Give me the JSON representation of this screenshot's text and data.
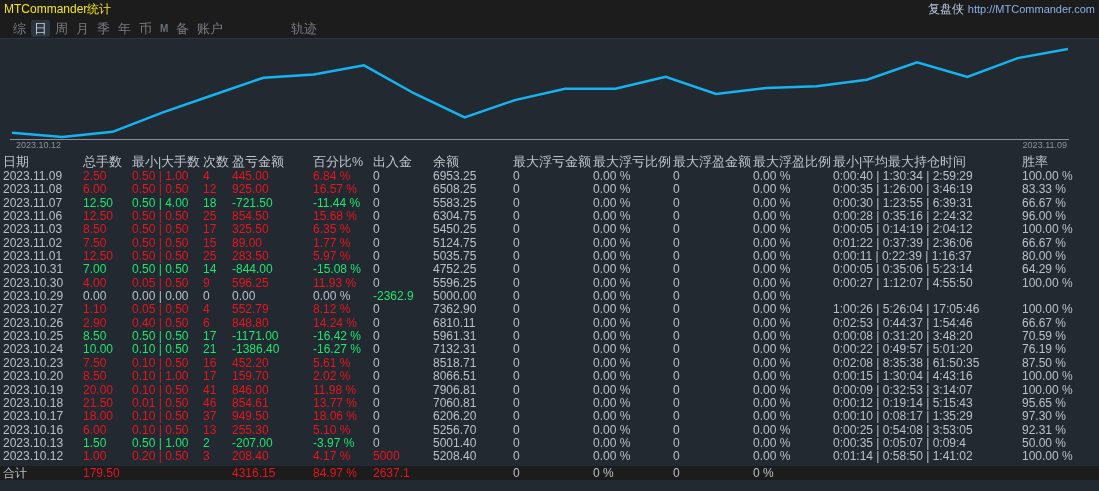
{
  "window": {
    "title": "MTCommander统计",
    "brand": "复盘侠",
    "url": "http://MTCommander.com"
  },
  "tabs": [
    {
      "label": "综",
      "selected": false,
      "kind": "text"
    },
    {
      "label": "日",
      "selected": true,
      "kind": "text"
    },
    {
      "label": "周",
      "selected": false,
      "kind": "text"
    },
    {
      "label": "月",
      "selected": false,
      "kind": "text"
    },
    {
      "label": "季",
      "selected": false,
      "kind": "text"
    },
    {
      "label": "年",
      "selected": false,
      "kind": "text"
    },
    {
      "label": "币",
      "selected": false,
      "kind": "text"
    },
    {
      "label": "M",
      "selected": false,
      "kind": "mark"
    },
    {
      "label": "备",
      "selected": false,
      "kind": "text"
    },
    {
      "label": "账户",
      "selected": false,
      "kind": "text"
    },
    {
      "label": "轨迹",
      "selected": false,
      "kind": "far"
    }
  ],
  "chart": {
    "start_label": "2023.10.12",
    "end_label": "2023.11.09"
  },
  "table": {
    "columns": [
      "日期",
      "总手数",
      "最小|大手数",
      "次数",
      "盈亏金额",
      "百分比%",
      "出入金",
      "余额",
      "最大浮亏金额",
      "最大浮亏比例",
      "最大浮盈金额",
      "最大浮盈比例",
      "最小|平均最大持仓时间",
      "胜率"
    ],
    "rows": [
      {
        "color": "#e8141e",
        "cells": [
          "2023.11.09",
          "2.50",
          "0.50 | 1.00",
          "4",
          "445.00",
          "6.84 %",
          {
            "text": "0",
            "color": "#b8c0cc"
          },
          "6953.25",
          "0",
          "0.00 %",
          "0",
          "0.00 %",
          "0:00:40 | 1:30:34 | 2:59:29",
          "100.00 %"
        ]
      },
      {
        "color": "#e8141e",
        "cells": [
          "2023.11.08",
          "6.00",
          "0.50 | 0.50",
          "12",
          "925.00",
          "16.57 %",
          {
            "text": "0",
            "color": "#b8c0cc"
          },
          "6508.25",
          "0",
          "0.00 %",
          "0",
          "0.00 %",
          "0:00:35 | 1:26:00 | 3:46:19",
          "83.33 %"
        ]
      },
      {
        "color": "#1ee66e",
        "cells": [
          "2023.11.07",
          "12.50",
          "0.50 | 4.00",
          "18",
          "-721.50",
          "-11.44 %",
          {
            "text": "0",
            "color": "#b8c0cc"
          },
          "5583.25",
          "0",
          "0.00 %",
          "0",
          "0.00 %",
          "0:00:30 | 1:23:55 | 6:39:31",
          "66.67 %"
        ]
      },
      {
        "color": "#e8141e",
        "cells": [
          "2023.11.06",
          "12.50",
          "0.50 | 0.50",
          "25",
          "854.50",
          "15.68 %",
          {
            "text": "0",
            "color": "#b8c0cc"
          },
          "6304.75",
          "0",
          "0.00 %",
          "0",
          "0.00 %",
          "0:00:28 | 0:35:16 | 2:24:32",
          "96.00 %"
        ]
      },
      {
        "color": "#e8141e",
        "cells": [
          "2023.11.03",
          "8.50",
          "0.50 | 0.50",
          "17",
          "325.50",
          "6.35 %",
          {
            "text": "0",
            "color": "#b8c0cc"
          },
          "5450.25",
          "0",
          "0.00 %",
          "0",
          "0.00 %",
          "0:00:05 | 0:14:19 | 2:04:12",
          "100.00 %"
        ]
      },
      {
        "color": "#e8141e",
        "cells": [
          "2023.11.02",
          "7.50",
          "0.50 | 0.50",
          "15",
          "89.00",
          "1.77 %",
          {
            "text": "0",
            "color": "#b8c0cc"
          },
          "5124.75",
          "0",
          "0.00 %",
          "0",
          "0.00 %",
          "0:01:22 | 0:37:39 | 2:36:06",
          "66.67 %"
        ]
      },
      {
        "color": "#e8141e",
        "cells": [
          "2023.11.01",
          "12.50",
          "0.50 | 0.50",
          "25",
          "283.50",
          "5.97 %",
          {
            "text": "0",
            "color": "#b8c0cc"
          },
          "5035.75",
          "0",
          "0.00 %",
          "0",
          "0.00 %",
          "0:00:11 | 0:22:39 | 1:16:37",
          "80.00 %"
        ]
      },
      {
        "color": "#1ee66e",
        "cells": [
          "2023.10.31",
          "7.00",
          "0.50 | 0.50",
          "14",
          "-844.00",
          "-15.08 %",
          {
            "text": "0",
            "color": "#b8c0cc"
          },
          "4752.25",
          "0",
          "0.00 %",
          "0",
          "0.00 %",
          "0:00:05 | 0:35:06 | 5:23:14",
          "64.29 %"
        ]
      },
      {
        "color": "#e8141e",
        "cells": [
          "2023.10.30",
          "4.00",
          "0.05 | 0.50",
          "9",
          "596.25",
          "11.93 %",
          {
            "text": "0",
            "color": "#b8c0cc"
          },
          "5596.25",
          "0",
          "0.00 %",
          "0",
          "0.00 %",
          "0:00:27 | 1:12:07 | 4:55:50",
          "100.00 %"
        ]
      },
      {
        "color": "#b8c0cc",
        "cells": [
          "2023.10.29",
          "0.00",
          "0.00 | 0.00",
          "0",
          "0.00",
          "0.00 %",
          {
            "text": "-2362.9",
            "color": "#1ee66e"
          },
          "5000.00",
          "0",
          "0.00 %",
          "0",
          "0.00 %",
          "",
          ""
        ]
      },
      {
        "color": "#e8141e",
        "cells": [
          "2023.10.27",
          "1.10",
          "0.05 | 0.50",
          "4",
          "552.79",
          "8.12 %",
          {
            "text": "0",
            "color": "#b8c0cc"
          },
          "7362.90",
          "0",
          "0.00 %",
          "0",
          "0.00 %",
          "1:00:26 | 5:26:04 | 17:05:46",
          "100.00 %"
        ]
      },
      {
        "color": "#e8141e",
        "cells": [
          "2023.10.26",
          "2.90",
          "0.40 | 0.50",
          "6",
          "848.80",
          "14.24 %",
          {
            "text": "0",
            "color": "#b8c0cc"
          },
          "6810.11",
          "0",
          "0.00 %",
          "0",
          "0.00 %",
          "0:02:53 | 0:44:37 | 1:54:46",
          "66.67 %"
        ]
      },
      {
        "color": "#1ee66e",
        "cells": [
          "2023.10.25",
          "8.50",
          "0.50 | 0.50",
          "17",
          "-1171.00",
          "-16.42 %",
          {
            "text": "0",
            "color": "#b8c0cc"
          },
          "5961.31",
          "0",
          "0.00 %",
          "0",
          "0.00 %",
          "0:00:08 | 0:31:20 | 3:48:20",
          "70.59 %"
        ]
      },
      {
        "color": "#1ee66e",
        "cells": [
          "2023.10.24",
          "10.00",
          "0.10 | 0.50",
          "21",
          "-1386.40",
          "-16.27 %",
          {
            "text": "0",
            "color": "#b8c0cc"
          },
          "7132.31",
          "0",
          "0.00 %",
          "0",
          "0.00 %",
          "0:00:22 | 0:49:57 | 5:01:20",
          "76.19 %"
        ]
      },
      {
        "color": "#e8141e",
        "cells": [
          "2023.10.23",
          "7.50",
          "0.10 | 0.50",
          "16",
          "452.20",
          "5.61 %",
          {
            "text": "0",
            "color": "#b8c0cc"
          },
          "8518.71",
          "0",
          "0.00 %",
          "0",
          "0.00 %",
          "0:02:08 | 8:35:38 | 61:50:35",
          "87.50 %"
        ]
      },
      {
        "color": "#e8141e",
        "cells": [
          "2023.10.20",
          "8.50",
          "0.10 | 1.00",
          "17",
          "159.70",
          "2.02 %",
          {
            "text": "0",
            "color": "#b8c0cc"
          },
          "8066.51",
          "0",
          "0.00 %",
          "0",
          "0.00 %",
          "0:00:15 | 1:30:04 | 4:43:16",
          "100.00 %"
        ]
      },
      {
        "color": "#e8141e",
        "cells": [
          "2023.10.19",
          "20.00",
          "0.10 | 0.50",
          "41",
          "846.00",
          "11.98 %",
          {
            "text": "0",
            "color": "#b8c0cc"
          },
          "7906.81",
          "0",
          "0.00 %",
          "0",
          "0.00 %",
          "0:00:09 | 0:32:53 | 3:14:07",
          "100.00 %"
        ]
      },
      {
        "color": "#e8141e",
        "cells": [
          "2023.10.18",
          "21.50",
          "0.01 | 0.50",
          "46",
          "854.61",
          "13.77 %",
          {
            "text": "0",
            "color": "#b8c0cc"
          },
          "7060.81",
          "0",
          "0.00 %",
          "0",
          "0.00 %",
          "0:00:12 | 0:19:14 | 5:15:43",
          "95.65 %"
        ]
      },
      {
        "color": "#e8141e",
        "cells": [
          "2023.10.17",
          "18.00",
          "0.10 | 0.50",
          "37",
          "949.50",
          "18.06 %",
          {
            "text": "0",
            "color": "#b8c0cc"
          },
          "6206.20",
          "0",
          "0.00 %",
          "0",
          "0.00 %",
          "0:00:10 | 0:08:17 | 1:35:29",
          "97.30 %"
        ]
      },
      {
        "color": "#e8141e",
        "cells": [
          "2023.10.16",
          "6.00",
          "0.10 | 0.50",
          "13",
          "255.30",
          "5.10 %",
          {
            "text": "0",
            "color": "#b8c0cc"
          },
          "5256.70",
          "0",
          "0.00 %",
          "0",
          "0.00 %",
          "0:00:25 | 0:54:08 | 3:53:05",
          "92.31 %"
        ]
      },
      {
        "color": "#1ee66e",
        "cells": [
          "2023.10.13",
          "1.50",
          "0.50 | 1.00",
          "2",
          "-207.00",
          "-3.97 %",
          {
            "text": "0",
            "color": "#b8c0cc"
          },
          "5001.40",
          "0",
          "0.00 %",
          "0",
          "0.00 %",
          "0:00:35 | 0:05:07 | 0:09:4",
          "50.00 %"
        ]
      },
      {
        "color": "#e8141e",
        "cells": [
          "2023.10.12",
          "1.00",
          "0.20 | 0.50",
          "3",
          "208.40",
          "4.17 %",
          {
            "text": "5000",
            "color": "#e8141e"
          },
          "5208.40",
          "0",
          "0.00 %",
          "0",
          "0.00 %",
          "0:01:14 | 0:58:50 | 1:41:02",
          "100.00 %"
        ]
      }
    ],
    "total": {
      "color": "#e8141e",
      "cells": [
        "合计",
        "179.50",
        "",
        "",
        "4316.15",
        "84.97 %",
        {
          "text": "2637.1",
          "color": "#e8141e"
        },
        "",
        "0",
        "0 %",
        "0",
        "0 %",
        "",
        ""
      ]
    }
  }
}
